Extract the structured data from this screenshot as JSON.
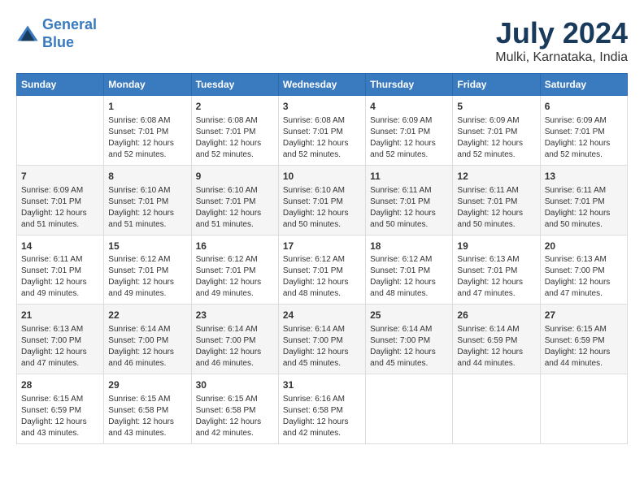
{
  "logo": {
    "line1": "General",
    "line2": "Blue"
  },
  "title": "July 2024",
  "subtitle": "Mulki, Karnataka, India",
  "columns": [
    "Sunday",
    "Monday",
    "Tuesday",
    "Wednesday",
    "Thursday",
    "Friday",
    "Saturday"
  ],
  "weeks": [
    [
      {
        "day": "",
        "info": ""
      },
      {
        "day": "1",
        "info": "Sunrise: 6:08 AM\nSunset: 7:01 PM\nDaylight: 12 hours\nand 52 minutes."
      },
      {
        "day": "2",
        "info": "Sunrise: 6:08 AM\nSunset: 7:01 PM\nDaylight: 12 hours\nand 52 minutes."
      },
      {
        "day": "3",
        "info": "Sunrise: 6:08 AM\nSunset: 7:01 PM\nDaylight: 12 hours\nand 52 minutes."
      },
      {
        "day": "4",
        "info": "Sunrise: 6:09 AM\nSunset: 7:01 PM\nDaylight: 12 hours\nand 52 minutes."
      },
      {
        "day": "5",
        "info": "Sunrise: 6:09 AM\nSunset: 7:01 PM\nDaylight: 12 hours\nand 52 minutes."
      },
      {
        "day": "6",
        "info": "Sunrise: 6:09 AM\nSunset: 7:01 PM\nDaylight: 12 hours\nand 52 minutes."
      }
    ],
    [
      {
        "day": "7",
        "info": "Sunrise: 6:09 AM\nSunset: 7:01 PM\nDaylight: 12 hours\nand 51 minutes."
      },
      {
        "day": "8",
        "info": "Sunrise: 6:10 AM\nSunset: 7:01 PM\nDaylight: 12 hours\nand 51 minutes."
      },
      {
        "day": "9",
        "info": "Sunrise: 6:10 AM\nSunset: 7:01 PM\nDaylight: 12 hours\nand 51 minutes."
      },
      {
        "day": "10",
        "info": "Sunrise: 6:10 AM\nSunset: 7:01 PM\nDaylight: 12 hours\nand 50 minutes."
      },
      {
        "day": "11",
        "info": "Sunrise: 6:11 AM\nSunset: 7:01 PM\nDaylight: 12 hours\nand 50 minutes."
      },
      {
        "day": "12",
        "info": "Sunrise: 6:11 AM\nSunset: 7:01 PM\nDaylight: 12 hours\nand 50 minutes."
      },
      {
        "day": "13",
        "info": "Sunrise: 6:11 AM\nSunset: 7:01 PM\nDaylight: 12 hours\nand 50 minutes."
      }
    ],
    [
      {
        "day": "14",
        "info": "Sunrise: 6:11 AM\nSunset: 7:01 PM\nDaylight: 12 hours\nand 49 minutes."
      },
      {
        "day": "15",
        "info": "Sunrise: 6:12 AM\nSunset: 7:01 PM\nDaylight: 12 hours\nand 49 minutes."
      },
      {
        "day": "16",
        "info": "Sunrise: 6:12 AM\nSunset: 7:01 PM\nDaylight: 12 hours\nand 49 minutes."
      },
      {
        "day": "17",
        "info": "Sunrise: 6:12 AM\nSunset: 7:01 PM\nDaylight: 12 hours\nand 48 minutes."
      },
      {
        "day": "18",
        "info": "Sunrise: 6:12 AM\nSunset: 7:01 PM\nDaylight: 12 hours\nand 48 minutes."
      },
      {
        "day": "19",
        "info": "Sunrise: 6:13 AM\nSunset: 7:01 PM\nDaylight: 12 hours\nand 47 minutes."
      },
      {
        "day": "20",
        "info": "Sunrise: 6:13 AM\nSunset: 7:00 PM\nDaylight: 12 hours\nand 47 minutes."
      }
    ],
    [
      {
        "day": "21",
        "info": "Sunrise: 6:13 AM\nSunset: 7:00 PM\nDaylight: 12 hours\nand 47 minutes."
      },
      {
        "day": "22",
        "info": "Sunrise: 6:14 AM\nSunset: 7:00 PM\nDaylight: 12 hours\nand 46 minutes."
      },
      {
        "day": "23",
        "info": "Sunrise: 6:14 AM\nSunset: 7:00 PM\nDaylight: 12 hours\nand 46 minutes."
      },
      {
        "day": "24",
        "info": "Sunrise: 6:14 AM\nSunset: 7:00 PM\nDaylight: 12 hours\nand 45 minutes."
      },
      {
        "day": "25",
        "info": "Sunrise: 6:14 AM\nSunset: 7:00 PM\nDaylight: 12 hours\nand 45 minutes."
      },
      {
        "day": "26",
        "info": "Sunrise: 6:14 AM\nSunset: 6:59 PM\nDaylight: 12 hours\nand 44 minutes."
      },
      {
        "day": "27",
        "info": "Sunrise: 6:15 AM\nSunset: 6:59 PM\nDaylight: 12 hours\nand 44 minutes."
      }
    ],
    [
      {
        "day": "28",
        "info": "Sunrise: 6:15 AM\nSunset: 6:59 PM\nDaylight: 12 hours\nand 43 minutes."
      },
      {
        "day": "29",
        "info": "Sunrise: 6:15 AM\nSunset: 6:58 PM\nDaylight: 12 hours\nand 43 minutes."
      },
      {
        "day": "30",
        "info": "Sunrise: 6:15 AM\nSunset: 6:58 PM\nDaylight: 12 hours\nand 42 minutes."
      },
      {
        "day": "31",
        "info": "Sunrise: 6:16 AM\nSunset: 6:58 PM\nDaylight: 12 hours\nand 42 minutes."
      },
      {
        "day": "",
        "info": ""
      },
      {
        "day": "",
        "info": ""
      },
      {
        "day": "",
        "info": ""
      }
    ]
  ]
}
